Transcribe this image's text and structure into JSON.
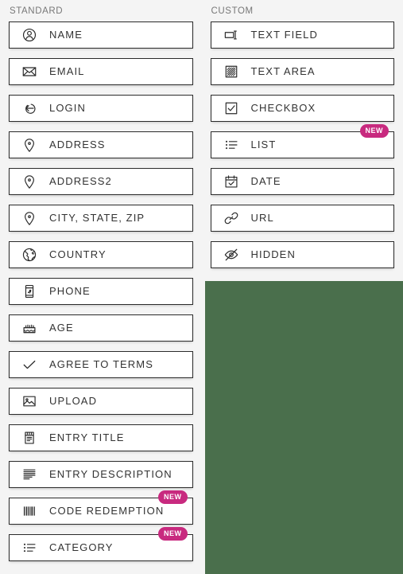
{
  "theme": {
    "page_background": "#f4f4f4",
    "panel_green": "#4a6f4c",
    "badge_pink": "#c82a7f",
    "button_background": "#ffffff",
    "button_border": "#2b2b2b",
    "label_color": "#333333",
    "heading_color": "#777777"
  },
  "columns": {
    "standard": {
      "heading": "STANDARD",
      "items": [
        {
          "label": "NAME",
          "icon": "user-icon",
          "badge": null
        },
        {
          "label": "EMAIL",
          "icon": "envelope-icon",
          "badge": null
        },
        {
          "label": "LOGIN",
          "icon": "login-arrow-icon",
          "badge": null
        },
        {
          "label": "ADDRESS",
          "icon": "map-pin-icon",
          "badge": null
        },
        {
          "label": "ADDRESS2",
          "icon": "map-pin-icon",
          "badge": null
        },
        {
          "label": "CITY, STATE, ZIP",
          "icon": "map-pin-icon",
          "badge": null
        },
        {
          "label": "COUNTRY",
          "icon": "globe-icon",
          "badge": null
        },
        {
          "label": "PHONE",
          "icon": "mobile-phone-icon",
          "badge": null
        },
        {
          "label": "AGE",
          "icon": "birthday-cake-icon",
          "badge": null
        },
        {
          "label": "AGREE TO TERMS",
          "icon": "checkmark-icon",
          "badge": null
        },
        {
          "label": "UPLOAD",
          "icon": "image-upload-icon",
          "badge": null
        },
        {
          "label": "ENTRY TITLE",
          "icon": "notepad-icon",
          "badge": null
        },
        {
          "label": "ENTRY DESCRIPTION",
          "icon": "text-lines-icon",
          "badge": null
        },
        {
          "label": "CODE REDEMPTION",
          "icon": "barcode-icon",
          "badge": "NEW"
        },
        {
          "label": "CATEGORY",
          "icon": "bullet-list-icon",
          "badge": "NEW"
        }
      ]
    },
    "custom": {
      "heading": "CUSTOM",
      "items": [
        {
          "label": "TEXT FIELD",
          "icon": "text-field-icon",
          "badge": null
        },
        {
          "label": "TEXT AREA",
          "icon": "text-area-icon",
          "badge": null
        },
        {
          "label": "CHECKBOX",
          "icon": "checkbox-icon",
          "badge": null
        },
        {
          "label": "LIST",
          "icon": "bullet-list-icon",
          "badge": "NEW"
        },
        {
          "label": "DATE",
          "icon": "calendar-check-icon",
          "badge": null
        },
        {
          "label": "URL",
          "icon": "link-chain-icon",
          "badge": null
        },
        {
          "label": "HIDDEN",
          "icon": "eye-slash-icon",
          "badge": null
        }
      ]
    }
  }
}
